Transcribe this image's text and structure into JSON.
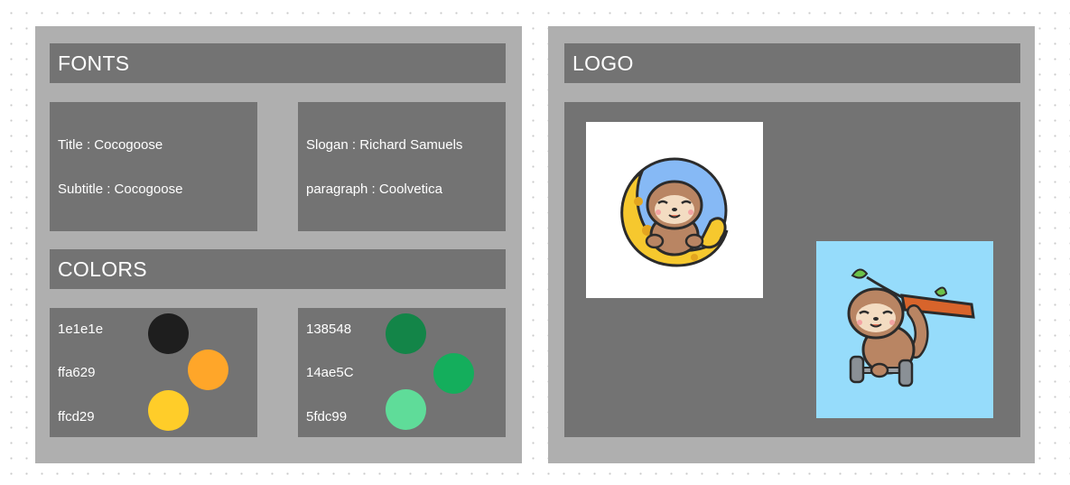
{
  "fonts": {
    "heading": "FONTS",
    "title_spec": "Title : Cocogoose",
    "subtitle_spec": "Subtitle : Cocogoose",
    "slogan_spec": "Slogan : Richard Samuels",
    "paragraph_spec": "paragraph : Coolvetica"
  },
  "colors": {
    "heading": "COLORS",
    "left": [
      {
        "label": "1e1e1e",
        "hex": "#1e1e1e"
      },
      {
        "label": "ffa629",
        "hex": "#ffa629"
      },
      {
        "label": "ffcd29",
        "hex": "#ffcd29"
      }
    ],
    "right": [
      {
        "label": "138548",
        "hex": "#138548"
      },
      {
        "label": "14ae5C",
        "hex": "#14ae5c"
      },
      {
        "label": "5fdc99",
        "hex": "#5fdc99"
      }
    ]
  },
  "logo": {
    "heading": "LOGO",
    "images": [
      {
        "icon": "sloth-on-moon-logo",
        "background": "#ffffff"
      },
      {
        "icon": "sloth-hanging-branch-logo",
        "background": "#96dcfb"
      }
    ]
  }
}
